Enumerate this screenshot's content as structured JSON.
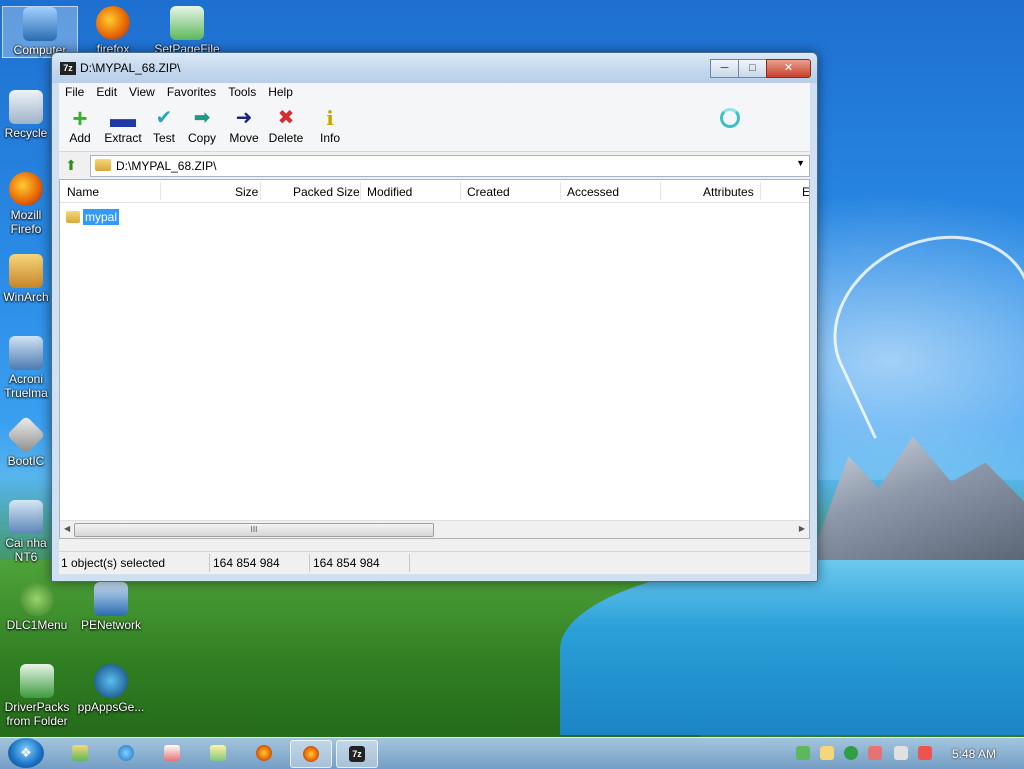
{
  "desktop": {
    "icons": [
      {
        "label": "Computer"
      },
      {
        "label": "firefox"
      },
      {
        "label": "SetPageFile"
      },
      {
        "label": "Recycle"
      },
      {
        "label": "Mozill Firefo"
      },
      {
        "label": "WinArch"
      },
      {
        "label": "Acroni Truelma"
      },
      {
        "label": "BootIC"
      },
      {
        "label": "Cai nha NT6"
      },
      {
        "label": "DLC1Menu"
      },
      {
        "label": "PENetwork"
      },
      {
        "label": "DriverPacks from Folder"
      },
      {
        "label": "ppAppsGe..."
      }
    ]
  },
  "window": {
    "title": "D:\\MYPAL_68.ZIP\\",
    "app_icon_text": "7z",
    "menu": [
      "File",
      "Edit",
      "View",
      "Favorites",
      "Tools",
      "Help"
    ],
    "toolbar": [
      {
        "label": "Add",
        "icon": "plus-icon",
        "color": "#2fb52f"
      },
      {
        "label": "Extract",
        "icon": "minus-icon",
        "color": "#1f3aa8"
      },
      {
        "label": "Test",
        "icon": "check-icon",
        "color": "#27a7b5"
      },
      {
        "label": "Copy",
        "icon": "double-arrow-icon",
        "color": "#1f9a84"
      },
      {
        "label": "Move",
        "icon": "arrow-right-icon",
        "color": "#1a237e"
      },
      {
        "label": "Delete",
        "icon": "x-icon",
        "color": "#d32f2f"
      },
      {
        "label": "Info",
        "icon": "info-icon",
        "color": "#c9a800"
      }
    ],
    "address": "D:\\MYPAL_68.ZIP\\",
    "columns": [
      "Name",
      "Size",
      "Packed Size",
      "Modified",
      "Created",
      "Accessed",
      "Attributes",
      "E"
    ],
    "rows": [
      {
        "name": "mypal",
        "selected": true
      }
    ],
    "scroll_grip": "III",
    "status": {
      "selected": "1 object(s) selected",
      "size": "164 854 984",
      "packed": "164 854 984"
    }
  },
  "taskbar": {
    "clock": "5:48 AM"
  }
}
